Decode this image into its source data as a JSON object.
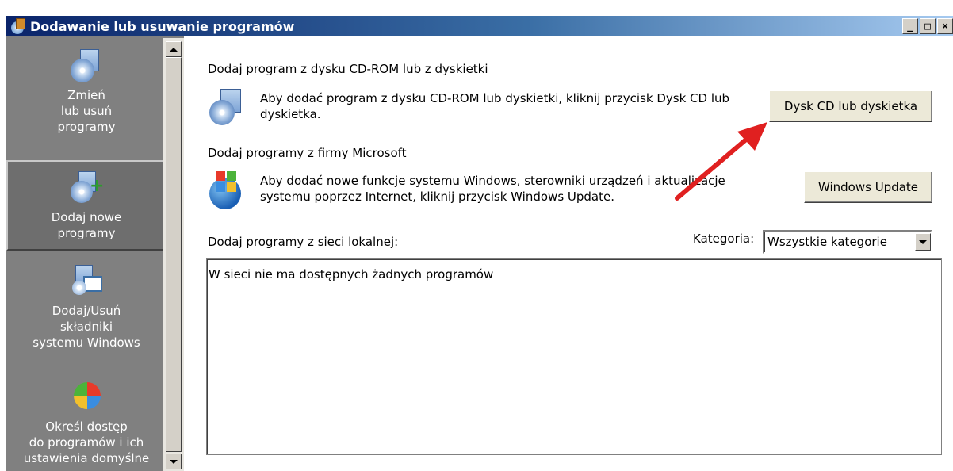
{
  "window": {
    "title": "Dodawanie lub usuwanie programów",
    "minimize": "_",
    "maximize": "□",
    "close": "×"
  },
  "sidebar": {
    "items": [
      {
        "lines": [
          "Zmień",
          "lub usuń",
          "programy"
        ],
        "icon": "cd-box-icon",
        "selected": false
      },
      {
        "lines": [
          "Dodaj nowe",
          "programy"
        ],
        "icon": "cd-add-icon",
        "selected": true
      },
      {
        "lines": [
          "Dodaj/Usuń",
          "składniki",
          "systemu Windows"
        ],
        "icon": "windows-components-icon",
        "selected": false
      },
      {
        "lines": [
          "Określ dostęp",
          "do programów i ich",
          "ustawienia domyślne"
        ],
        "icon": "program-access-icon",
        "selected": false
      }
    ]
  },
  "main": {
    "cd_section": {
      "title": "Dodaj program z dysku CD-ROM lub z dyskietki",
      "desc_line1": "Aby dodać program z dysku CD-ROM lub dyskietki, kliknij przycisk Dysk CD lub",
      "desc_line2": "dyskietka.",
      "button": "Dysk CD lub dyskietka"
    },
    "ms_section": {
      "title": "Dodaj programy z firmy Microsoft",
      "desc_line1": "Aby dodać nowe funkcje systemu Windows, sterowniki urządzeń i aktualizacje",
      "desc_line2": "systemu poprzez Internet, kliknij przycisk Windows Update.",
      "button": "Windows Update"
    },
    "network_section": {
      "title": "Dodaj programy z sieci lokalnej:",
      "category_label": "Kategoria:",
      "category_value": "Wszystkie kategorie",
      "list_empty_text": "W sieci nie ma dostępnych żadnych programów"
    }
  },
  "colors": {
    "titlebar_start": "#0a246a",
    "titlebar_end": "#a6caf0",
    "sidebar_bg": "#808080",
    "annotation_arrow": "#e02020"
  }
}
